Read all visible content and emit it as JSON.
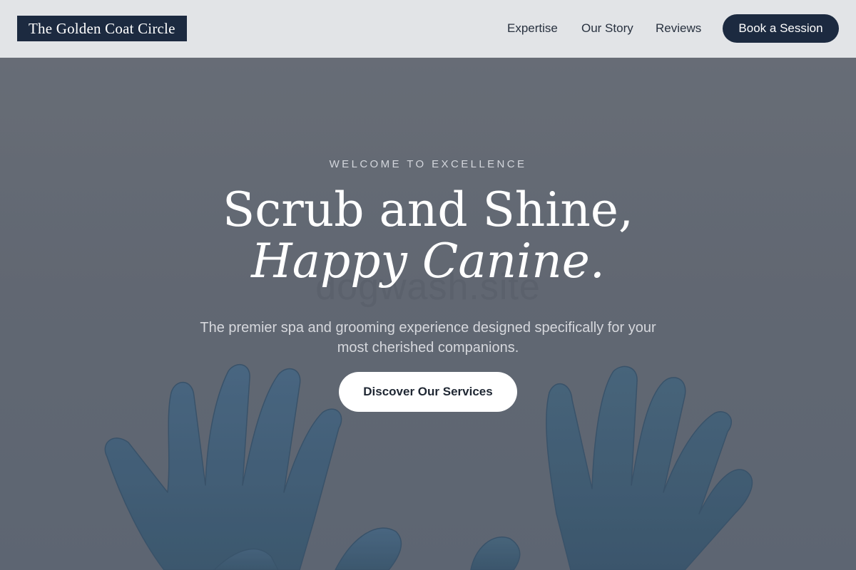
{
  "header": {
    "logo_text": "The Golden Coat Circle",
    "nav": [
      {
        "label": "Expertise"
      },
      {
        "label": "Our Story"
      },
      {
        "label": "Reviews"
      }
    ],
    "book_label": "Book a Session"
  },
  "hero": {
    "watermark": "dogwash.site",
    "eyebrow": "WELCOME TO EXCELLENCE",
    "headline_line1": "Scrub and Shine,",
    "headline_line2": "Happy Canine.",
    "subtext": "The premier spa and grooming experience designed specifically for your most cherished companions.",
    "cta_label": "Discover Our Services",
    "background_image": "blue-gloved-hands-photo"
  },
  "colors": {
    "brand_navy": "#1c2a40",
    "header_bg": "#e2e4e7",
    "hero_overlay": "#636a75",
    "glove_blue": "#3e5f7a",
    "white": "#ffffff"
  }
}
